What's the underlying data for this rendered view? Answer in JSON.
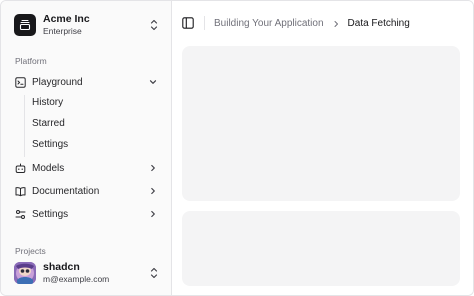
{
  "team": {
    "name": "Acme Inc",
    "plan": "Enterprise"
  },
  "groups": {
    "platform": "Platform",
    "projects": "Projects"
  },
  "nav": {
    "playground": "Playground",
    "sub": [
      "History",
      "Starred",
      "Settings"
    ],
    "models": "Models",
    "documentation": "Documentation",
    "settings": "Settings"
  },
  "user": {
    "name": "shadcn",
    "email": "m@example.com"
  },
  "breadcrumb": {
    "parent": "Building Your Application",
    "current": "Data Fetching"
  },
  "icons": {
    "team_logo": "gallery-vertical-end-icon",
    "playground": "square-terminal-icon",
    "models": "bot-icon",
    "documentation": "book-open-icon",
    "settings": "settings-2-icon",
    "toggle": "panel-left-icon"
  },
  "colors": {
    "sidebar_bg": "#fafafa",
    "panel_bg": "#f4f4f5",
    "text": "#18181b",
    "muted": "#71717a"
  }
}
